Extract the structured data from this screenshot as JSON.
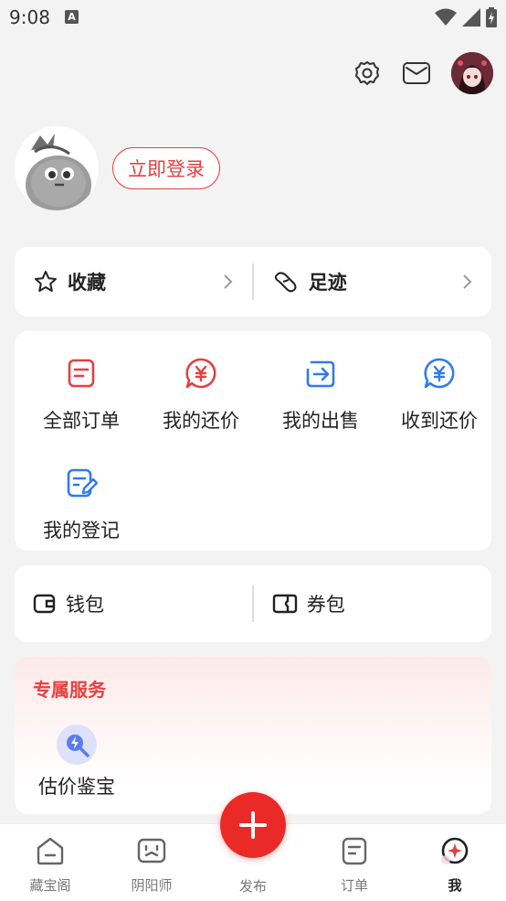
{
  "status": {
    "time": "9:08",
    "badge": "A"
  },
  "profile": {
    "login_label": "立即登录"
  },
  "favorites": {
    "collect_label": "收藏",
    "footprint_label": "足迹"
  },
  "orders": [
    {
      "label": "全部订单",
      "icon": "order-list-icon"
    },
    {
      "label": "我的还价",
      "icon": "yen-bubble-icon"
    },
    {
      "label": "我的出售",
      "icon": "sell-arrow-icon"
    },
    {
      "label": "收到还价",
      "icon": "yen-bubble-blue-icon"
    },
    {
      "label": "我的登记",
      "icon": "register-edit-icon"
    }
  ],
  "wallet": {
    "wallet_label": "钱包",
    "coupon_label": "券包"
  },
  "service": {
    "title": "专属服务",
    "items": [
      {
        "label": "估价鉴宝",
        "icon": "appraise-icon"
      }
    ]
  },
  "tabbar": {
    "items": [
      {
        "label": "藏宝阁",
        "icon": "home-icon"
      },
      {
        "label": "阴阳师",
        "icon": "game-icon"
      },
      {
        "label": "发布",
        "icon": "plus-icon"
      },
      {
        "label": "订单",
        "icon": "order-icon"
      },
      {
        "label": "我",
        "icon": "me-icon"
      }
    ],
    "active": "我"
  },
  "colors": {
    "accent": "#e64040",
    "blue": "#2f7bf0",
    "publish": "#ea2a27"
  }
}
